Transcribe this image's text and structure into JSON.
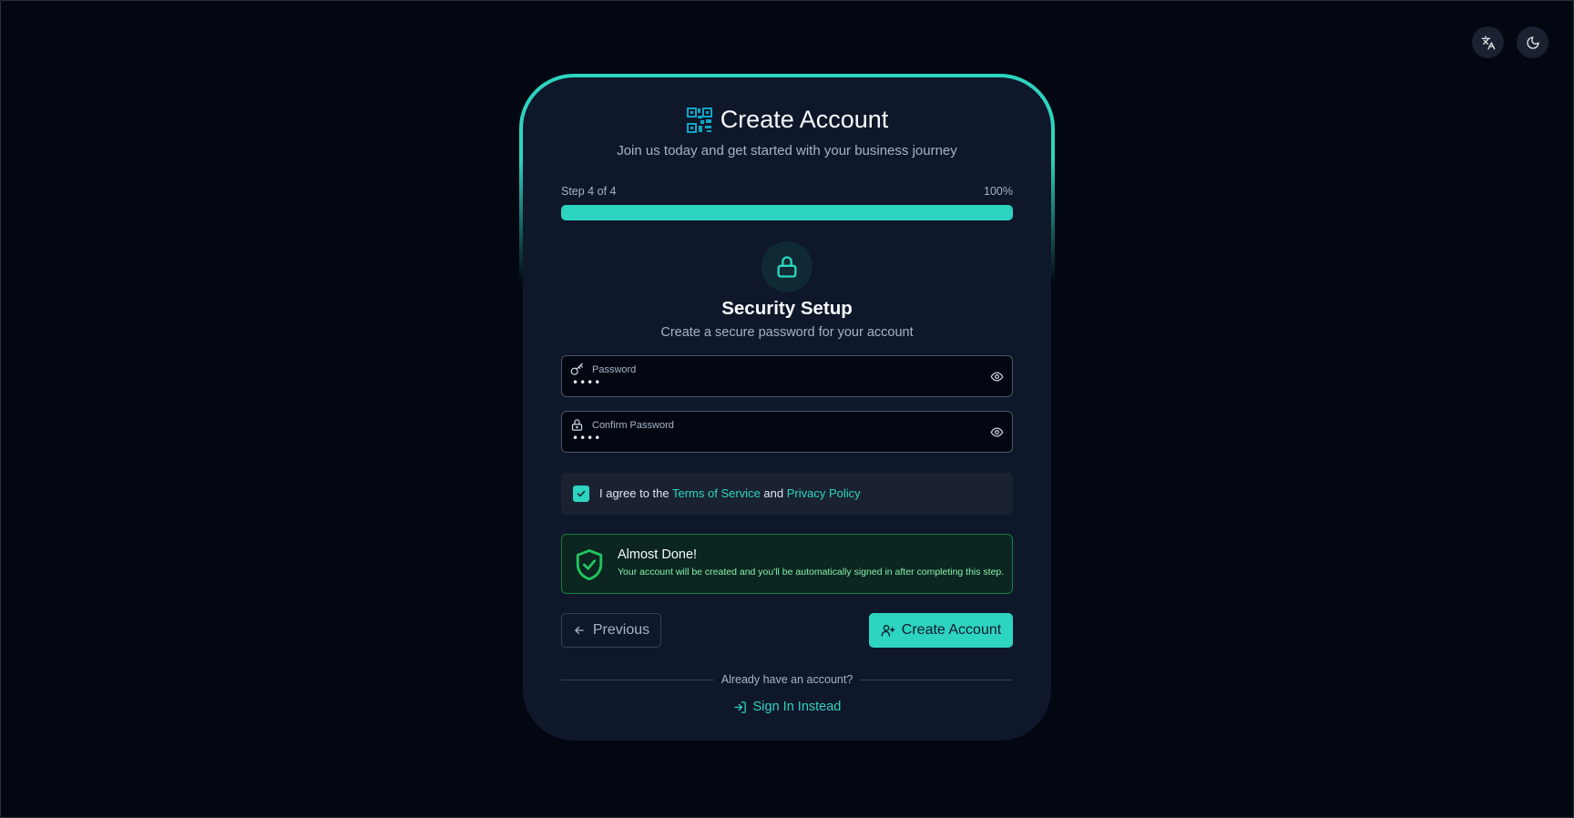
{
  "header": {
    "language_icon": "translate-icon",
    "theme_icon": "moon-icon"
  },
  "card": {
    "logo_icon": "qr-code-icon",
    "title": "Create Account",
    "subtitle": "Join us today and get started with your business journey"
  },
  "progress": {
    "step_label": "Step 4 of 4",
    "percent_label": "100%",
    "value": 1.0
  },
  "section": {
    "icon": "lock-icon",
    "title": "Security Setup",
    "subtitle": "Create a secure password for your account"
  },
  "fields": {
    "password": {
      "label": "Password",
      "value": "••••",
      "icon": "key-icon"
    },
    "confirm_password": {
      "label": "Confirm Password",
      "value": "••••",
      "icon": "lock-icon"
    }
  },
  "agree": {
    "checked": true,
    "prefix": "I agree to the ",
    "terms_link": "Terms of Service",
    "middle": " and ",
    "privacy_link": "Privacy Policy"
  },
  "notice": {
    "icon": "shield-check-icon",
    "title": "Almost Done!",
    "text": "Your account will be created and you'll be automatically signed in after completing this step."
  },
  "actions": {
    "previous_label": "Previous",
    "create_label": "Create Account"
  },
  "footer": {
    "divider_text": "Already have an account?",
    "signin_label": "Sign In Instead"
  },
  "colors": {
    "accent": "#2dd4bf",
    "background": "#030712",
    "card": "#0f172a",
    "success_border": "#15803d",
    "success_text": "#86efac"
  }
}
